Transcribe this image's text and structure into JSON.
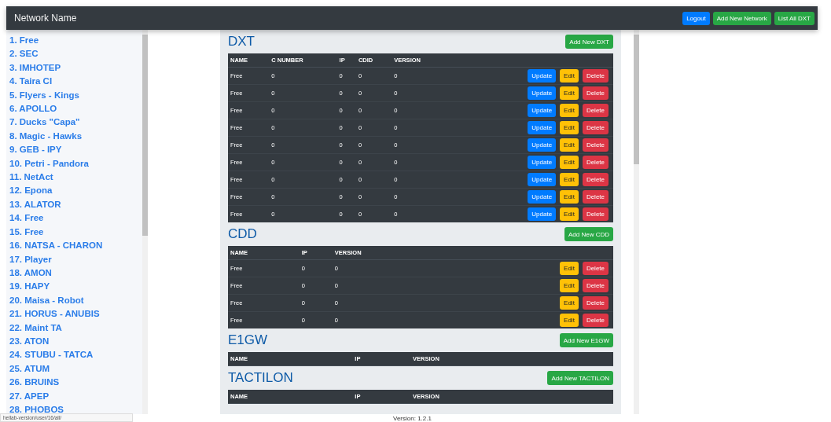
{
  "navbar": {
    "brand": "Network Name",
    "buttons": [
      {
        "label": "Logout",
        "kind": "primary"
      },
      {
        "label": "Add New Network",
        "kind": "success"
      },
      {
        "label": "List All DXT",
        "kind": "success"
      }
    ]
  },
  "sidebar": {
    "items": [
      "1. Free",
      "2. SEC",
      "3. IMHOTEP",
      "4. Taira CI",
      "5. Flyers - Kings",
      "6. APOLLO",
      "7. Ducks \"Capa\"",
      "8. Magic - Hawks",
      "9. GEB - IPY",
      "10. Petri - Pandora",
      "11. NetAct",
      "12. Epona",
      "13. ALATOR",
      "14. Free",
      "15. Free",
      "16. NATSA - CHARON",
      "17. Player",
      "18. AMON",
      "19. HAPY",
      "20. Maisa - Robot",
      "21. HORUS - ANUBIS",
      "22. Maint TA",
      "23. ATON",
      "24. STUBU - TATCA",
      "25. ATUM",
      "26. BRUINS",
      "27. APEP",
      "28. PHOBOS"
    ]
  },
  "sections": [
    {
      "title": "DXT",
      "add_button": "Add New DXT",
      "columns": [
        "NAME",
        "C NUMBER",
        "IP",
        "CDID",
        "VERSION"
      ],
      "rows": [
        {
          "cells": [
            "Free",
            "0",
            "0",
            "0",
            "0"
          ],
          "actions": [
            {
              "label": "Update",
              "kind": "primary"
            },
            {
              "label": "Edit",
              "kind": "warning"
            },
            {
              "label": "Delete",
              "kind": "danger"
            }
          ]
        },
        {
          "cells": [
            "Free",
            "0",
            "0",
            "0",
            "0"
          ],
          "actions": [
            {
              "label": "Update",
              "kind": "primary"
            },
            {
              "label": "Edit",
              "kind": "warning"
            },
            {
              "label": "Delete",
              "kind": "danger"
            }
          ]
        },
        {
          "cells": [
            "Free",
            "0",
            "0",
            "0",
            "0"
          ],
          "actions": [
            {
              "label": "Update",
              "kind": "primary"
            },
            {
              "label": "Edit",
              "kind": "warning"
            },
            {
              "label": "Delete",
              "kind": "danger"
            }
          ]
        },
        {
          "cells": [
            "Free",
            "0",
            "0",
            "0",
            "0"
          ],
          "actions": [
            {
              "label": "Update",
              "kind": "primary"
            },
            {
              "label": "Edit",
              "kind": "warning"
            },
            {
              "label": "Delete",
              "kind": "danger"
            }
          ]
        },
        {
          "cells": [
            "Free",
            "0",
            "0",
            "0",
            "0"
          ],
          "actions": [
            {
              "label": "Update",
              "kind": "primary"
            },
            {
              "label": "Edit",
              "kind": "warning"
            },
            {
              "label": "Delete",
              "kind": "danger"
            }
          ]
        },
        {
          "cells": [
            "Free",
            "0",
            "0",
            "0",
            "0"
          ],
          "actions": [
            {
              "label": "Update",
              "kind": "primary"
            },
            {
              "label": "Edit",
              "kind": "warning"
            },
            {
              "label": "Delete",
              "kind": "danger"
            }
          ]
        },
        {
          "cells": [
            "Free",
            "0",
            "0",
            "0",
            "0"
          ],
          "actions": [
            {
              "label": "Update",
              "kind": "primary"
            },
            {
              "label": "Edit",
              "kind": "warning"
            },
            {
              "label": "Delete",
              "kind": "danger"
            }
          ]
        },
        {
          "cells": [
            "Free",
            "0",
            "0",
            "0",
            "0"
          ],
          "actions": [
            {
              "label": "Update",
              "kind": "primary"
            },
            {
              "label": "Edit",
              "kind": "warning"
            },
            {
              "label": "Delete",
              "kind": "danger"
            }
          ]
        },
        {
          "cells": [
            "Free",
            "0",
            "0",
            "0",
            "0"
          ],
          "actions": [
            {
              "label": "Update",
              "kind": "primary"
            },
            {
              "label": "Edit",
              "kind": "warning"
            },
            {
              "label": "Delete",
              "kind": "danger"
            }
          ]
        }
      ]
    },
    {
      "title": "CDD",
      "add_button": "Add New CDD",
      "columns": [
        "NAME",
        "IP",
        "VERSION"
      ],
      "rows": [
        {
          "cells": [
            "Free",
            "0",
            "0"
          ],
          "actions": [
            {
              "label": "Edit",
              "kind": "warning"
            },
            {
              "label": "Delete",
              "kind": "danger"
            }
          ]
        },
        {
          "cells": [
            "Free",
            "0",
            "0"
          ],
          "actions": [
            {
              "label": "Edit",
              "kind": "warning"
            },
            {
              "label": "Delete",
              "kind": "danger"
            }
          ]
        },
        {
          "cells": [
            "Free",
            "0",
            "0"
          ],
          "actions": [
            {
              "label": "Edit",
              "kind": "warning"
            },
            {
              "label": "Delete",
              "kind": "danger"
            }
          ]
        },
        {
          "cells": [
            "Free",
            "0",
            "0"
          ],
          "actions": [
            {
              "label": "Edit",
              "kind": "warning"
            },
            {
              "label": "Delete",
              "kind": "danger"
            }
          ]
        }
      ]
    },
    {
      "title": "E1GW",
      "add_button": "Add New E1GW",
      "columns": [
        "NAME",
        "IP",
        "VERSION"
      ]
    },
    {
      "title": "TACTILON",
      "add_button": "Add New TACTILON",
      "columns": [
        "NAME",
        "IP",
        "VERSION"
      ]
    }
  ],
  "footer": {
    "url": "hellab-version/user/16/all/",
    "version": "Version: 1.2.1"
  }
}
